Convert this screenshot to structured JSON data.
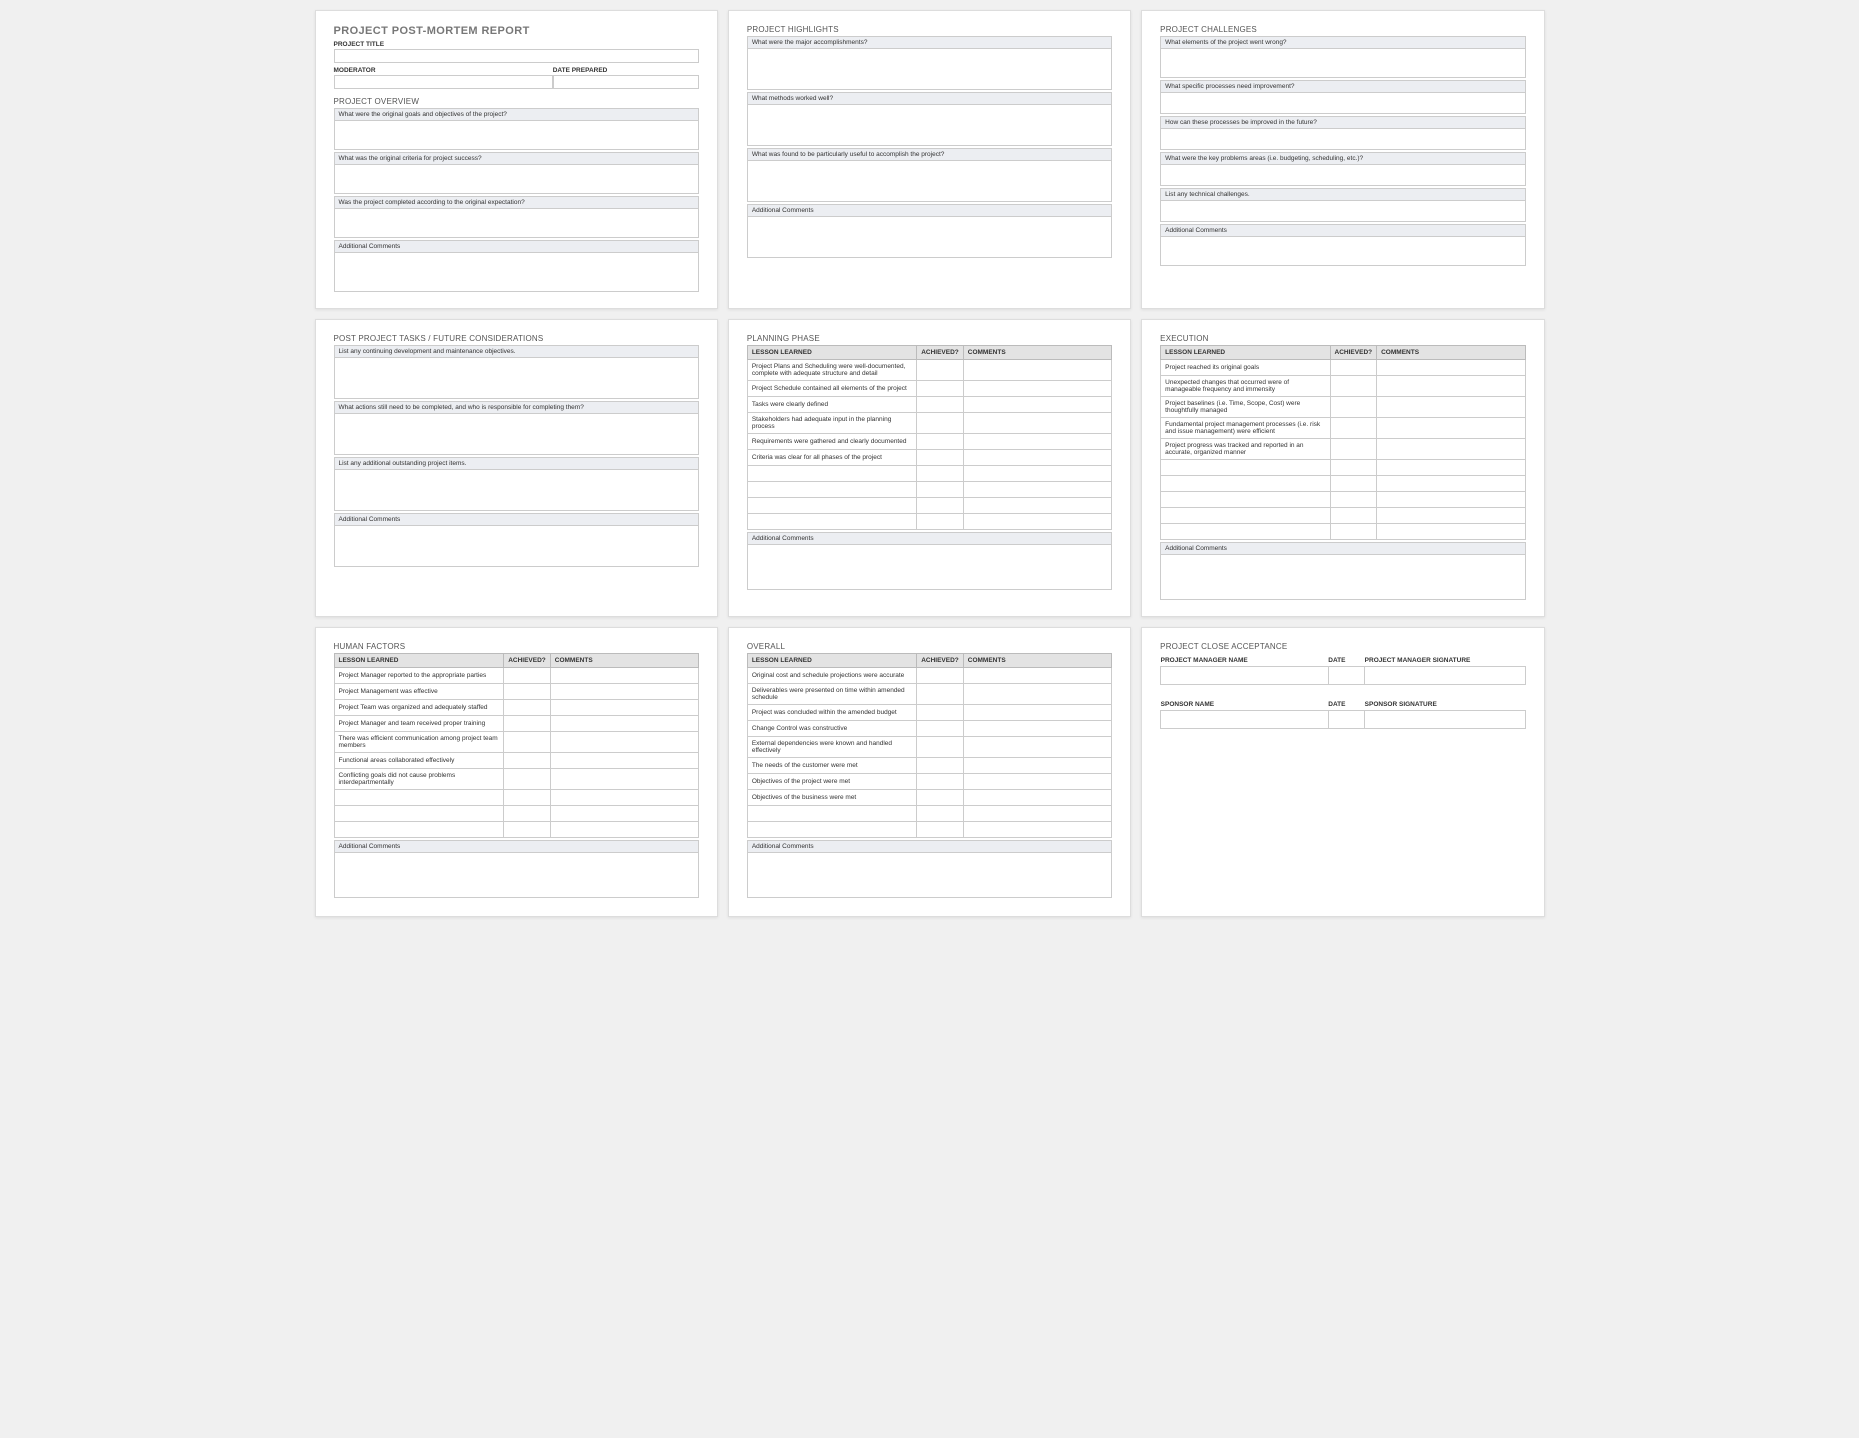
{
  "report": {
    "title": "PROJECT POST-MORTEM REPORT",
    "fields": {
      "project_title": "PROJECT TITLE",
      "moderator": "MODERATOR",
      "date_prepared": "DATE PREPARED"
    }
  },
  "overview": {
    "title": "PROJECT OVERVIEW",
    "q1": "What were the original goals and objectives of the project?",
    "q2": "What was the original criteria for project success?",
    "q3": "Was the project completed according to the original expectation?",
    "comments": "Additional Comments"
  },
  "highlights": {
    "title": "PROJECT HIGHLIGHTS",
    "q1": "What were the major accomplishments?",
    "q2": "What methods worked well?",
    "q3": "What was found to be particularly useful to accomplish the project?",
    "comments": "Additional Comments"
  },
  "challenges": {
    "title": "PROJECT CHALLENGES",
    "q1": "What elements of the project went wrong?",
    "q2": "What specific processes need improvement?",
    "q3": "How can these processes be improved in the future?",
    "q4": "What were the key problems areas (i.e. budgeting, scheduling, etc.)?",
    "q5": "List any technical challenges.",
    "comments": "Additional Comments"
  },
  "postproject": {
    "title": "POST PROJECT TASKS / FUTURE CONSIDERATIONS",
    "q1": "List any continuing development and maintenance objectives.",
    "q2": "What actions still need to be completed, and who is responsible for completing them?",
    "q3": "List any additional outstanding project items.",
    "comments": "Additional Comments"
  },
  "table_headers": {
    "lesson": "LESSON LEARNED",
    "achieved": "ACHIEVED?",
    "comments": "COMMENTS"
  },
  "planning": {
    "title": "PLANNING PHASE",
    "rows": [
      "Project Plans and Scheduling were well-documented, complete with adequate structure and detail",
      "Project Schedule contained all elements of the project",
      "Tasks were clearly defined",
      "Stakeholders had adequate input in the planning process",
      "Requirements were gathered and clearly documented",
      "Criteria was clear for all phases of the project",
      "",
      "",
      "",
      ""
    ],
    "comments": "Additional Comments"
  },
  "execution": {
    "title": "EXECUTION",
    "rows": [
      "Project reached its original goals",
      "Unexpected changes that occurred were of manageable frequency and immensity",
      "Project baselines (i.e. Time, Scope, Cost) were thoughtfully managed",
      "Fundamental project management processes (i.e. risk and issue management) were efficient",
      "Project progress was tracked and reported in an accurate, organized manner",
      "",
      "",
      "",
      "",
      ""
    ],
    "comments": "Additional Comments"
  },
  "human": {
    "title": "HUMAN FACTORS",
    "rows": [
      "Project Manager reported to the appropriate parties",
      "Project Management was effective",
      "Project Team was organized and adequately staffed",
      "Project Manager and team received proper training",
      "There was efficient communication among project team members",
      "Functional areas collaborated effectively",
      "Conflicting goals did not cause problems interdepartmentally",
      "",
      "",
      ""
    ],
    "comments": "Additional Comments"
  },
  "overall": {
    "title": "OVERALL",
    "rows": [
      "Original cost and schedule projections were accurate",
      "Deliverables were presented on time within amended schedule",
      "Project was concluded within the amended budget",
      "Change Control was constructive",
      "External dependencies were known and handled effectively",
      "The needs of the customer were met",
      "Objectives of the project were met",
      "Objectives of the business were met",
      "",
      ""
    ],
    "comments": "Additional Comments"
  },
  "close": {
    "title": "PROJECT CLOSE ACCEPTANCE",
    "pm_name": "PROJECT MANAGER NAME",
    "date": "DATE",
    "pm_sig": "PROJECT MANAGER SIGNATURE",
    "sp_name": "SPONSOR NAME",
    "sp_sig": "SPONSOR SIGNATURE"
  }
}
